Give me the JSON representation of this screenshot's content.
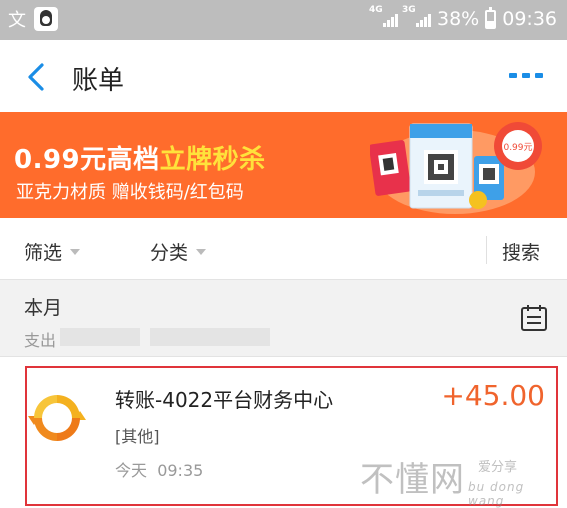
{
  "status_bar": {
    "left_glyph": "文",
    "network_1": "4G",
    "network_2": "3G",
    "battery_percent": "38%",
    "time": "09:36",
    "battery_level": 0.38
  },
  "header": {
    "title": "账单",
    "accent_color": "#1a8de6"
  },
  "banner": {
    "line1_prefix": "0.99元高档",
    "line1_highlight": "立牌秒杀",
    "line2": "亚克力材质 赠收钱码/红包码",
    "price_badge": "0.99元",
    "background_color": "#ff6c2c",
    "highlight_color": "#ffe23b"
  },
  "filters": {
    "filter_label": "筛选",
    "category_label": "分类",
    "search_label": "搜索"
  },
  "month_section": {
    "title": "本月",
    "expense_label": "支出"
  },
  "transaction": {
    "title": "转账-4022平台财务中心",
    "amount": "+45.00",
    "category": "[其他]",
    "date": "今天",
    "time": "09:35",
    "amount_color": "#f0642d"
  },
  "watermark": {
    "main": "不懂网",
    "sub_cn": "爱分享",
    "sub_pinyin": "bu dong wang"
  }
}
